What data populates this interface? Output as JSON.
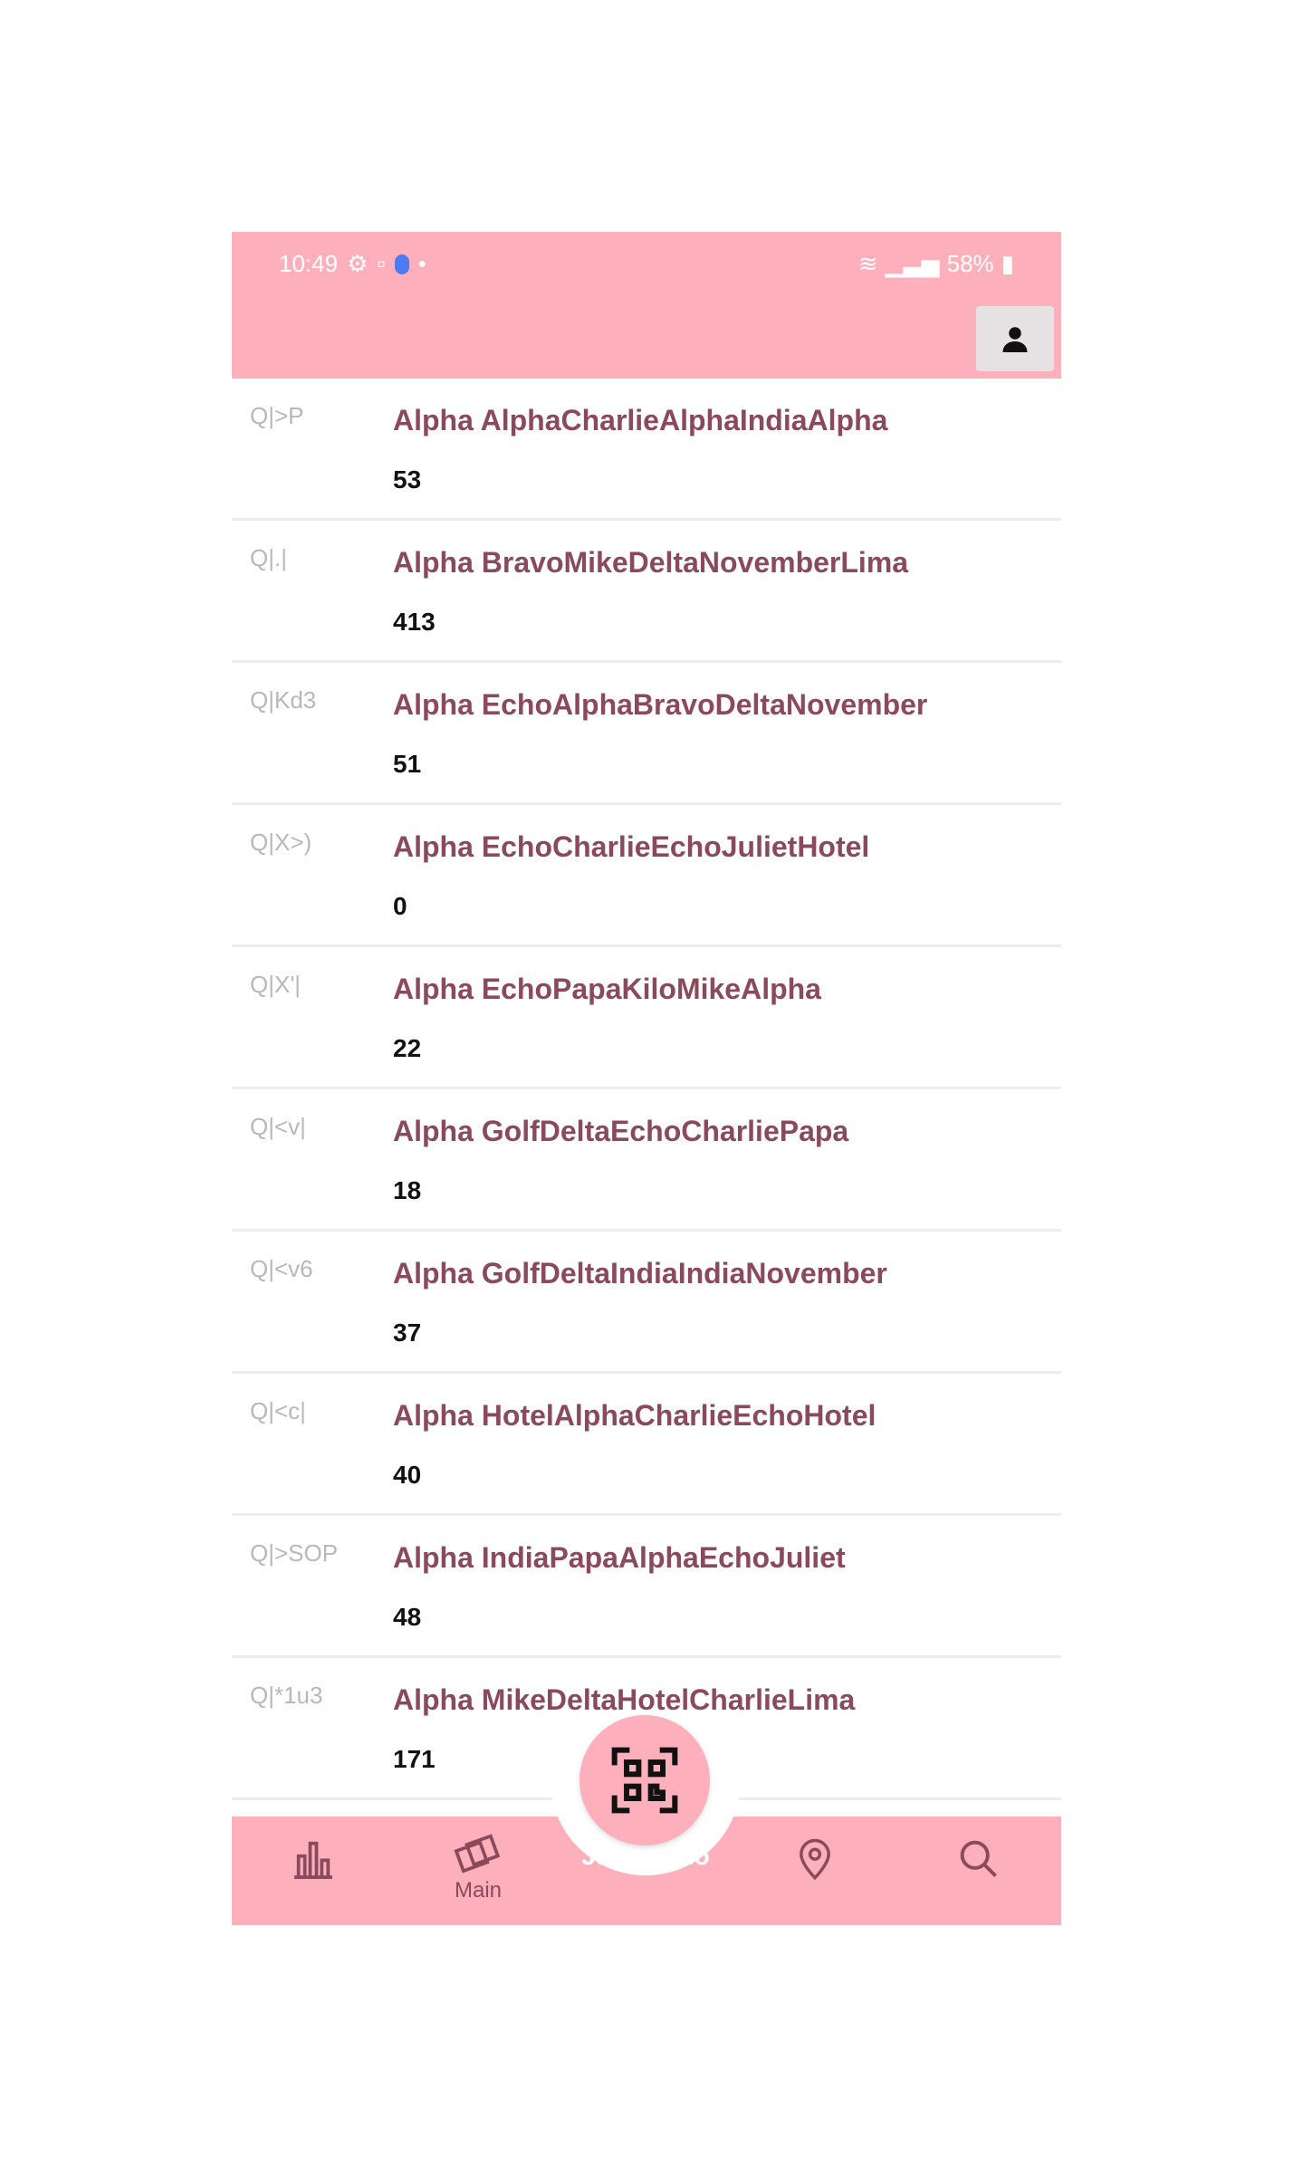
{
  "status_bar": {
    "time": "10:49",
    "battery": "58%"
  },
  "items": [
    {
      "code": "Q|>P",
      "name": "Alpha AlphaCharlieAlphaIndiaAlpha",
      "count": "53"
    },
    {
      "code": "Q|.|",
      "name": "Alpha BravoMikeDeltaNovemberLima",
      "count": "413"
    },
    {
      "code": "Q|Kd3",
      "name": "Alpha EchoAlphaBravoDeltaNovember",
      "count": "51"
    },
    {
      "code": "Q|X>)",
      "name": "Alpha EchoCharlieEchoJulietHotel",
      "count": "0"
    },
    {
      "code": "Q|X'|",
      "name": "Alpha EchoPapaKiloMikeAlpha",
      "count": "22"
    },
    {
      "code": "Q|<v|",
      "name": "Alpha GolfDeltaEchoCharliePapa",
      "count": "18"
    },
    {
      "code": "Q|<v6",
      "name": "Alpha GolfDeltaIndiaIndiaNovember",
      "count": "37"
    },
    {
      "code": "Q|<c|",
      "name": "Alpha HotelAlphaCharlieEchoHotel",
      "count": "40"
    },
    {
      "code": "Q|>SOP",
      "name": "Alpha IndiaPapaAlphaEchoJuliet",
      "count": "48"
    },
    {
      "code": "Q|*1u3",
      "name": "Alpha MikeDeltaHotelCharlieLima",
      "count": "171"
    }
  ],
  "bottom_nav": {
    "main_label": "Main",
    "center_label": "JulietEcho"
  },
  "colors": {
    "accent": "#fdb0bb",
    "item_text": "#8a4a5c"
  }
}
